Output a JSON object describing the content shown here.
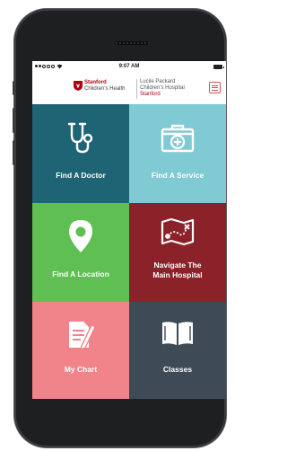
{
  "status_bar": {
    "time": "9:07 AM"
  },
  "header": {
    "brand_line1": "Stanford",
    "brand_line2": "Children's Health",
    "hospital_line1": "Lucile Packard",
    "hospital_line2": "Children's Hospital",
    "hospital_line3": "Stanford",
    "menu_icon": "hamburger-menu-icon"
  },
  "tiles": [
    {
      "label": "Find A Doctor",
      "icon": "stethoscope-icon",
      "color": "#1f6475"
    },
    {
      "label": "Find A Service",
      "icon": "medical-kit-icon",
      "color": "#7fcad3"
    },
    {
      "label": "Find A Location",
      "icon": "location-pin-icon",
      "color": "#5fbf53"
    },
    {
      "label_line1": "Navigate The",
      "label_line2": "Main Hospital",
      "icon": "map-route-icon",
      "color": "#8b2229"
    },
    {
      "label": "My Chart",
      "icon": "document-edit-icon",
      "color": "#f0848a"
    },
    {
      "label": "Classes",
      "icon": "open-book-icon",
      "color": "#3e4a55"
    }
  ]
}
